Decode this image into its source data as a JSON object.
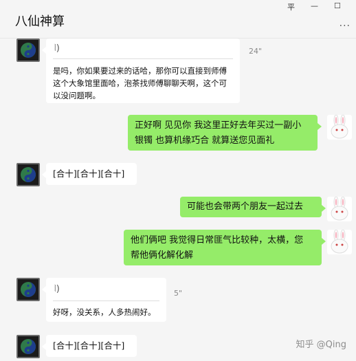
{
  "window": {
    "title": "八仙神算",
    "minimize_label": "平",
    "maximize_label": "☐",
    "more_label": "···"
  },
  "messages": {
    "m1": {
      "voice_icon": "voice-wave-icon",
      "duration": "24\"",
      "text_line1": "是吗，你如果要过来的话哈，那你可以直接到师傅",
      "text_line2": "这个大象馆里面哈，泡茶找师傅聊聊天啊，这个可",
      "text_line3": "以没问题啊。"
    },
    "m2": {
      "line1": "正好啊 见见你  我这里正好去年买过一副小",
      "line2": "银镯  也算机缘巧合 就算送您见面礼"
    },
    "m3": {
      "text": "[合十][合十][合十]"
    },
    "m4": {
      "text": "可能也会带两个朋友一起过去"
    },
    "m5": {
      "line1": "他们俩吧 我觉得日常匪气比较种，太横，您",
      "line2": "帮他俩化解化解"
    },
    "m6": {
      "voice_icon": "voice-wave-icon",
      "duration": "5\"",
      "text": "好呀，没关系，人多热闹好。"
    },
    "m7": {
      "text": "[合十][合十][合十]"
    }
  },
  "watermark": "知乎 @Qing",
  "colors": {
    "sent_bubble": "#95ec69",
    "received_bubble": "#ffffff",
    "background": "#f5f5f5"
  }
}
